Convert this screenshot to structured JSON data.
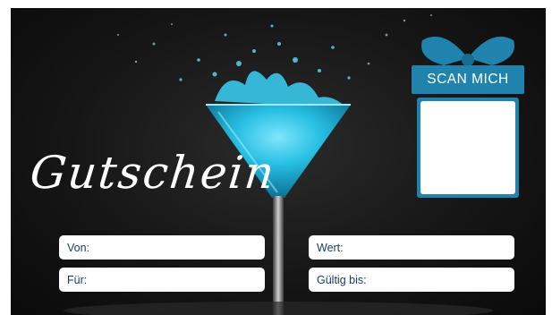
{
  "card": {
    "title": "Gutschein",
    "scan_label": "SCAN MICH",
    "fields": {
      "von": "Von:",
      "fuer": "Für:",
      "wert": "Wert:",
      "gueltig": "Gültig bis:"
    }
  },
  "colors": {
    "accent": "#1f83ad",
    "drink": "#2ec5e6",
    "background": "#141414",
    "field_text": "#1a3c66"
  },
  "icons": [
    "cocktail-glass-image",
    "gift-box-icon"
  ]
}
